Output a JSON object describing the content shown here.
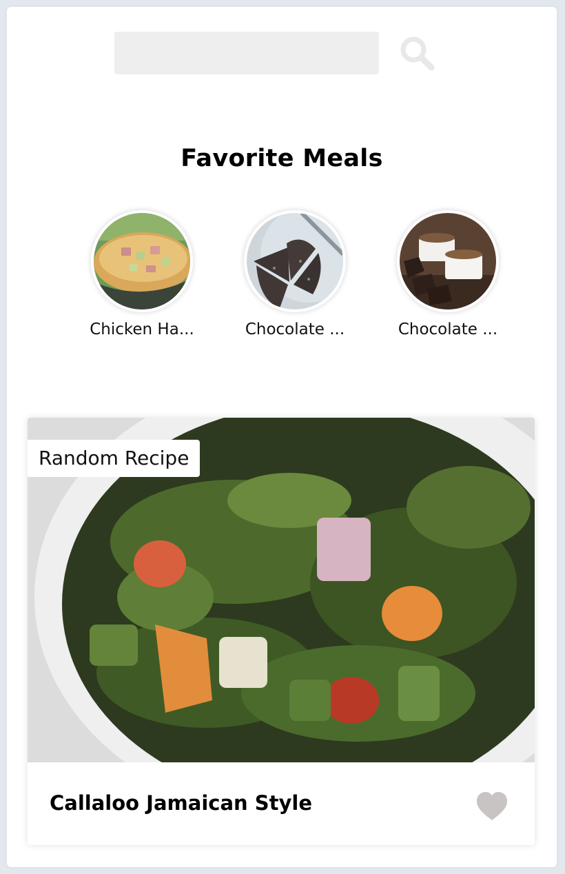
{
  "search": {
    "value": "",
    "placeholder": ""
  },
  "favorites": {
    "title": "Favorite Meals",
    "items": [
      {
        "name": "Chicken Ha..."
      },
      {
        "name": "Chocolate ..."
      },
      {
        "name": "Chocolate ..."
      }
    ]
  },
  "random": {
    "tag": "Random Recipe",
    "meal_name": "Callaloo Jamaican Style"
  },
  "colors": {
    "page_bg": "#e3e8ef",
    "search_bg": "#eeeeee",
    "search_icon": "#e8e8e8",
    "heart_icon": "#c9c4c4"
  }
}
